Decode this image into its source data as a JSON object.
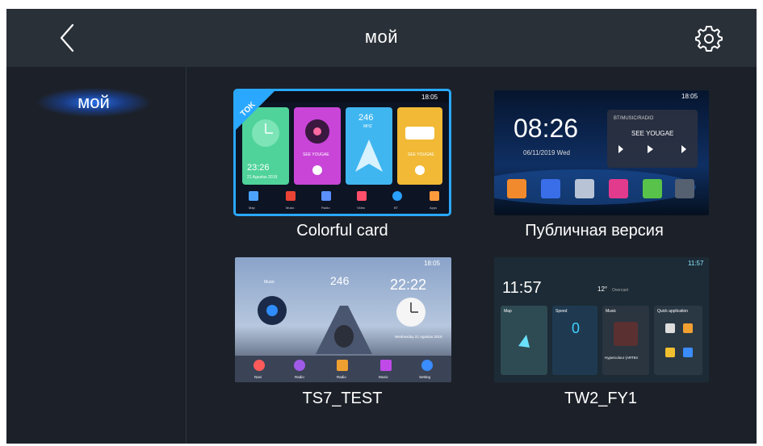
{
  "header": {
    "title": "мой"
  },
  "sidebar": {
    "items": [
      {
        "label": "мой",
        "selected": true
      }
    ]
  },
  "themes": [
    {
      "name": "Colorful card",
      "selected": true,
      "preview": {
        "badge": "TOK",
        "status_time": "18:05",
        "clock_time": "23:26",
        "clock_date": "21 Agustus 2019",
        "music_caption": "SEE YOUGAE",
        "radio_number": "246",
        "radio_unit": "MHZ",
        "radio_caption": "SEE YOUGAE",
        "dock": [
          "Map",
          "Music",
          "Radio",
          "Video",
          "BT",
          "Apps"
        ]
      }
    },
    {
      "name": "Публичная версия",
      "selected": false,
      "preview": {
        "status_time": "18:05",
        "clock_time": "08:26",
        "clock_date": "06/11/2019 Wed",
        "media_header": "BT/MUSIC/RADIO",
        "media_title": "SEE YOUGAE"
      }
    },
    {
      "name": "TS7_TEST",
      "selected": false,
      "preview": {
        "status_time": "18:05",
        "music_label": "Music",
        "radio_number": "246",
        "clock_time": "22:22",
        "clock_date": "Wednesday 21 Agustus 2019",
        "dock": [
          "Navi",
          "Radio",
          "Radio",
          "Music",
          "Setting"
        ]
      }
    },
    {
      "name": "TW2_FY1",
      "selected": false,
      "preview": {
        "status_time": "11:57",
        "clock_time": "11:57",
        "weather_temp": "12°",
        "weather_label": "Overcast",
        "tiles": [
          "Map",
          "Speed",
          "Music",
          "Quick application"
        ],
        "speed_value": "0",
        "track": "Hypercolour (ART84"
      }
    }
  ]
}
